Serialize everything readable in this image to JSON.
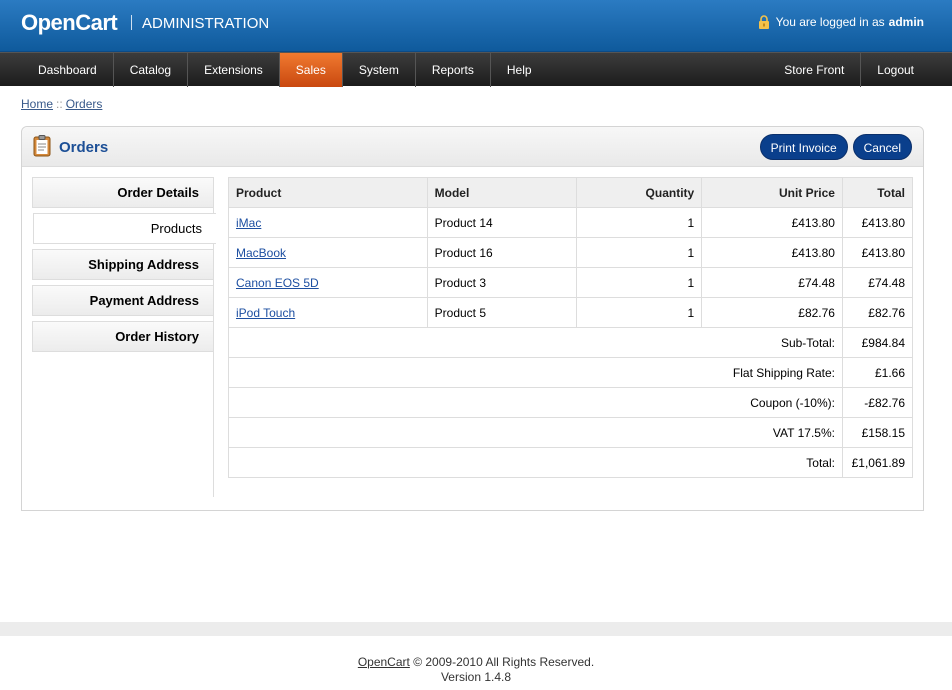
{
  "header": {
    "logo": "OpenCart",
    "subtitle": "ADMINISTRATION",
    "logged_in_prefix": "You are logged in as",
    "username": "admin"
  },
  "menu": {
    "left": [
      "Dashboard",
      "Catalog",
      "Extensions",
      "Sales",
      "System",
      "Reports",
      "Help"
    ],
    "active": "Sales",
    "right": [
      "Store Front",
      "Logout"
    ]
  },
  "breadcrumb": {
    "home": "Home",
    "separator": "::",
    "current": "Orders"
  },
  "box": {
    "title": "Orders",
    "print_button": "Print Invoice",
    "cancel_button": "Cancel"
  },
  "tabs": [
    "Order Details",
    "Products",
    "Shipping Address",
    "Payment Address",
    "Order History"
  ],
  "active_tab": "Products",
  "table": {
    "headers": [
      "Product",
      "Model",
      "Quantity",
      "Unit Price",
      "Total"
    ],
    "rows": [
      {
        "product": "iMac",
        "model": "Product 14",
        "quantity": "1",
        "unit_price": "£413.80",
        "total": "£413.80"
      },
      {
        "product": "MacBook",
        "model": "Product 16",
        "quantity": "1",
        "unit_price": "£413.80",
        "total": "£413.80"
      },
      {
        "product": "Canon EOS 5D",
        "model": "Product 3",
        "quantity": "1",
        "unit_price": "£74.48",
        "total": "£74.48"
      },
      {
        "product": "iPod Touch",
        "model": "Product 5",
        "quantity": "1",
        "unit_price": "£82.76",
        "total": "£82.76"
      }
    ],
    "totals": [
      {
        "label": "Sub-Total:",
        "value": "£984.84"
      },
      {
        "label": "Flat Shipping Rate:",
        "value": "£1.66"
      },
      {
        "label": "Coupon (-10%):",
        "value": "-£82.76"
      },
      {
        "label": "VAT 17.5%:",
        "value": "£158.15"
      },
      {
        "label": "Total:",
        "value": "£1,061.89"
      }
    ]
  },
  "footer": {
    "brand": "OpenCart",
    "copyright": "© 2009-2010 All Rights Reserved.",
    "version": "Version 1.4.8"
  },
  "colors": {
    "header_blue": "#1a6bb0",
    "active_menu": "#e0601e",
    "button": "#0a3f8c",
    "title": "#1c4f96"
  },
  "icons": {
    "lock": "lock-icon",
    "orders": "clipboard-icon"
  }
}
